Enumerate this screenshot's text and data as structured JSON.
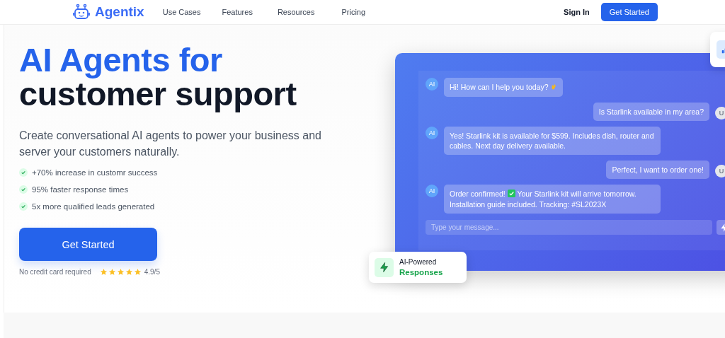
{
  "nav": {
    "brand": "Agentix",
    "links": [
      "Use Cases",
      "Features",
      "Resources",
      "Pricing"
    ],
    "sign_in": "Sign In",
    "cta": "Get Started"
  },
  "hero": {
    "title_line1": "AI Agents for",
    "title_line2": "customer support",
    "subtitle": "Create conversational AI agents to power your business and server your customers naturally.",
    "features": [
      "+70% increase in customr success",
      "95% faster response times",
      "5x more qualified leads generated"
    ],
    "cta": "Get Started",
    "note": "No credit card required",
    "stars": 5,
    "rating": "4.9/5"
  },
  "chat": {
    "messages": [
      {
        "kind": "ai",
        "avatar": "AI",
        "parts": [
          {
            "kind": "text",
            "text": "Hi! How can I help you today?"
          },
          {
            "kind": "wave"
          }
        ]
      },
      {
        "kind": "user",
        "avatar": "U",
        "parts": [
          {
            "kind": "text",
            "text": "Is Starlink available in my area?"
          }
        ]
      },
      {
        "kind": "ai",
        "avatar": "AI",
        "parts": [
          {
            "kind": "text",
            "text": "Yes! Starlink kit is available for $599. Includes dish, router and cables. Next day delivery available."
          }
        ]
      },
      {
        "kind": "user",
        "avatar": "U",
        "parts": [
          {
            "kind": "text",
            "text": "Perfect, I want to order one!"
          }
        ]
      },
      {
        "kind": "ai",
        "avatar": "AI",
        "parts": [
          {
            "kind": "text",
            "text": "Order confirmed!"
          },
          {
            "kind": "check"
          },
          {
            "kind": "text",
            "text": "Your Starlink kit will arrive tomorrow. Installation guide included. Tracking: #SL2023X"
          }
        ]
      }
    ],
    "input": {
      "placeholder": "Type your message..."
    },
    "badge": {
      "line1": "AI-Powered",
      "line2": "Responses"
    }
  }
}
